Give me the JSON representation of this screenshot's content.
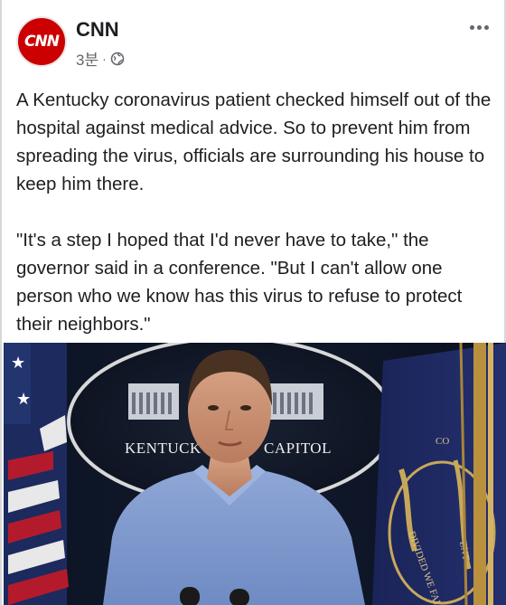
{
  "post": {
    "page_name": "CNN",
    "avatar_label": "CNN",
    "time": "3분",
    "separator": "·",
    "privacy_icon": "globe-icon",
    "more_icon": "more-options-icon",
    "paragraphs": [
      "A Kentucky coronavirus patient checked himself out of the hospital against medical advice. So to prevent him from spreading the virus, officials are surrounding his house to keep him there.",
      "\"It's a step I hoped that I'd never have to take,\" the governor said in a conference. \"But I can't allow one person who we know has this virus to refuse to protect their neighbors.\""
    ]
  },
  "photo": {
    "seal_text_left": "KENTUCK",
    "seal_text_right": "CAPITOL",
    "flag_text_top": "CO",
    "flag_text_bottom": "DIVIDED WE FALL",
    "flag_text_side": "ENT"
  },
  "colors": {
    "brand_red": "#cc0000",
    "text": "#1c1e21",
    "meta": "#65676b"
  }
}
